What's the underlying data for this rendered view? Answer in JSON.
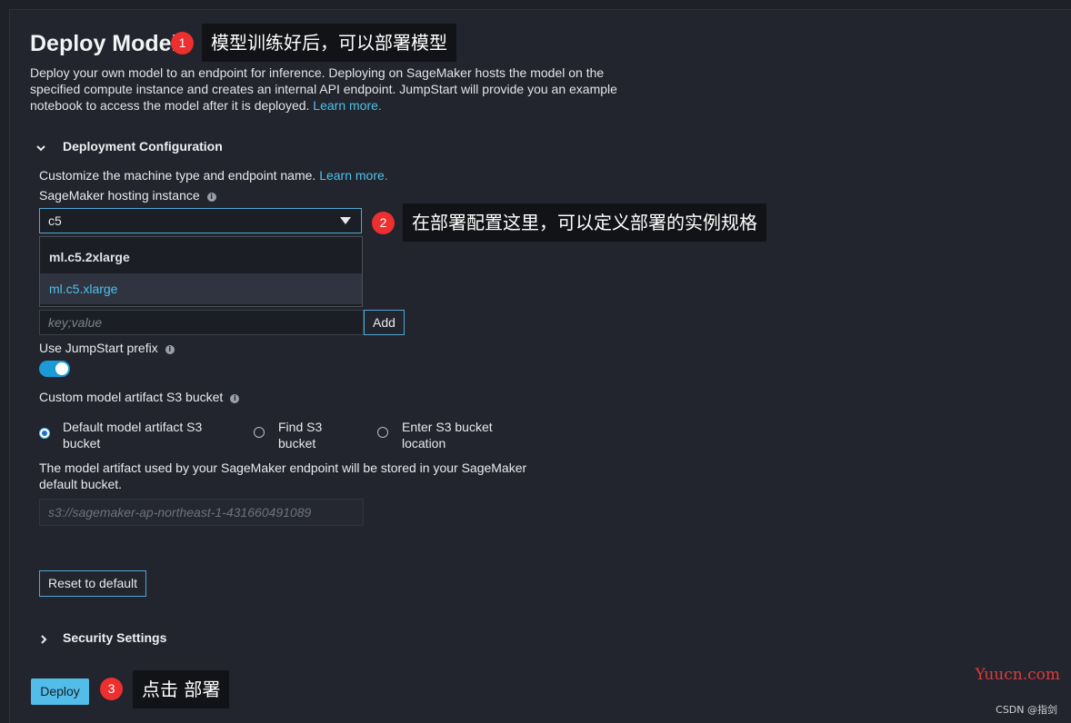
{
  "header": {
    "title": "Deploy Model",
    "description": "Deploy your own model to an endpoint for inference. Deploying on SageMaker hosts the model on the specified compute instance and creates an internal API endpoint. JumpStart will provide you an example notebook to access the model after it is deployed.",
    "learn_more": "Learn more."
  },
  "deployment_config": {
    "heading": "Deployment Configuration",
    "intro": "Customize the machine type and endpoint name.",
    "learn_more": "Learn more.",
    "instance_label": "SageMaker hosting instance",
    "instance_value": "c5",
    "instance_options": [
      "ml.c5.2xlarge",
      "ml.c5.xlarge"
    ],
    "tag_placeholder": "key;value",
    "add_label": "Add",
    "prefix_label": "Use JumpStart prefix",
    "prefix_enabled": true,
    "s3_label": "Custom model artifact S3 bucket",
    "s3_options": [
      {
        "line1": "Default model artifact S3",
        "line2": "bucket",
        "selected": true
      },
      {
        "line1": "Find S3",
        "line2": "bucket",
        "selected": false
      },
      {
        "line1": "Enter S3 bucket",
        "line2": "location",
        "selected": false
      }
    ],
    "s3_note_line1": "The model artifact used by your SageMaker endpoint will be stored in your SageMaker",
    "s3_note_line2": "default bucket.",
    "s3_placeholder": "s3://sagemaker-ap-northeast-1-431660491089",
    "reset_label": "Reset to default"
  },
  "security": {
    "heading": "Security Settings"
  },
  "deploy_label": "Deploy",
  "annotations": [
    {
      "num": "1",
      "text": "模型训练好后，可以部署模型"
    },
    {
      "num": "2",
      "text": "在部署配置这里，可以定义部署的实例规格"
    },
    {
      "num": "3",
      "text": "点击 部署"
    }
  ],
  "watermarks": {
    "site": "Yuucn.com",
    "author": "CSDN @指剑"
  },
  "colors": {
    "accent": "#4fc1e9",
    "deploy_button": "#52bde9",
    "badge": "#ee2f2f",
    "background": "#22252d"
  }
}
